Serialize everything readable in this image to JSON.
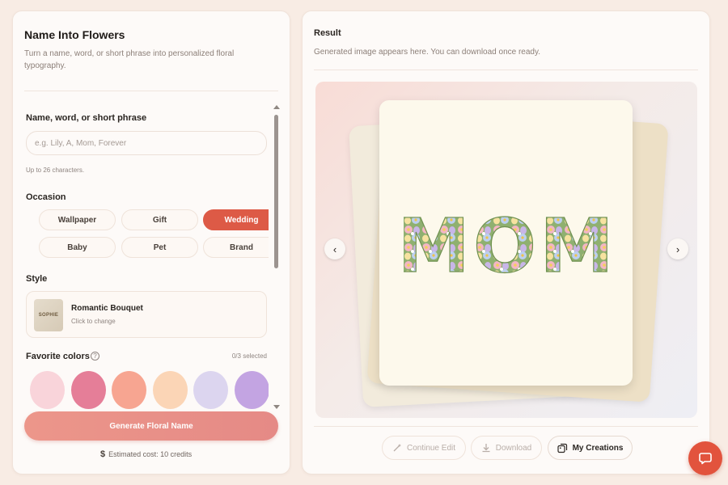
{
  "left_panel": {
    "title": "Name Into Flowers",
    "description": "Turn a name, word, or short phrase into personalized floral typography.",
    "name_label": "Name, word, or short phrase",
    "name_placeholder": "e.g. Lily, A, Mom, Forever",
    "name_value": "",
    "name_hint": "Up to 26 characters.",
    "occasion_label": "Occasion",
    "occasions": [
      {
        "label": "Wallpaper",
        "selected": false
      },
      {
        "label": "Gift",
        "selected": false
      },
      {
        "label": "Wedding",
        "selected": true
      },
      {
        "label": "Baby",
        "selected": false
      },
      {
        "label": "Pet",
        "selected": false
      },
      {
        "label": "Brand",
        "selected": false
      }
    ],
    "style_label": "Style",
    "style": {
      "thumb_text": "SOPHIE",
      "name": "Romantic Bouquet",
      "sub": "Click to change"
    },
    "favorite_colors_label": "Favorite colors",
    "favorite_colors_count": "0/3 selected",
    "favorite_colors": [
      "#f9d4da",
      "#e57e98",
      "#f7a591",
      "#fbd5b6",
      "#dcd5ef",
      "#c3a4e2"
    ],
    "generate_label": "Generate Floral Name",
    "cost": "Estimated cost: 10 credits"
  },
  "right_panel": {
    "title": "Result",
    "subtitle": "Generated image appears here. You can download once ready.",
    "preview_word": "MOM",
    "actions": {
      "continue_edit": "Continue Edit",
      "download": "Download",
      "my_creations": "My Creations"
    }
  },
  "colors": {
    "accent": "#dd5a46",
    "generate_button": "#ea928a",
    "chat_button": "#e2533d"
  }
}
